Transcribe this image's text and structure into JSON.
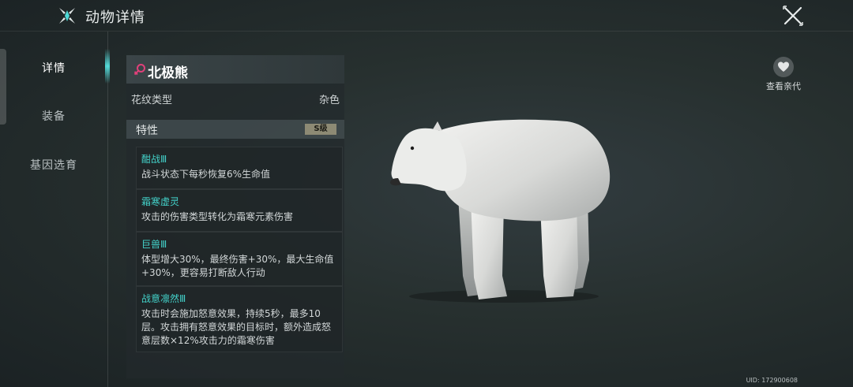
{
  "header": {
    "title": "动物详情"
  },
  "nav": {
    "items": [
      "详情",
      "装备",
      "基因选育"
    ],
    "active_index": 0
  },
  "animal": {
    "name": "北极熊",
    "gender_icon": "female-symbol-icon",
    "pattern_label": "花纹类型",
    "pattern_value": "杂色"
  },
  "traits": {
    "label": "特性",
    "grade": "S级",
    "items": [
      {
        "name": "酣战Ⅲ",
        "desc": [
          "战斗状态下每秒恢复6%生命值"
        ]
      },
      {
        "name": "霜寒虚灵",
        "desc": [
          "攻击的伤害类型转化为霜寒元素伤害"
        ]
      },
      {
        "name": "巨兽Ⅲ",
        "desc": [
          "体型增大30%，最终伤害+30%，最大生命值",
          "+30%，更容易打断敌人行动"
        ]
      },
      {
        "name": "战意凛然Ⅲ",
        "desc": [
          "攻击时会施加怒意效果，持续5秒，最多10",
          "层。攻击拥有怒意效果的目标时，额外造成怒",
          "意层数×12%攻击力的霜寒伤害"
        ]
      }
    ]
  },
  "relatives": {
    "label": "查看亲代",
    "icon": "heart-icon"
  },
  "footer": {
    "uid": "UID: 172900608"
  },
  "colors": {
    "accent": "#43d1c9",
    "gender": "#e0407a",
    "grade_bg": "#8d8a74"
  }
}
